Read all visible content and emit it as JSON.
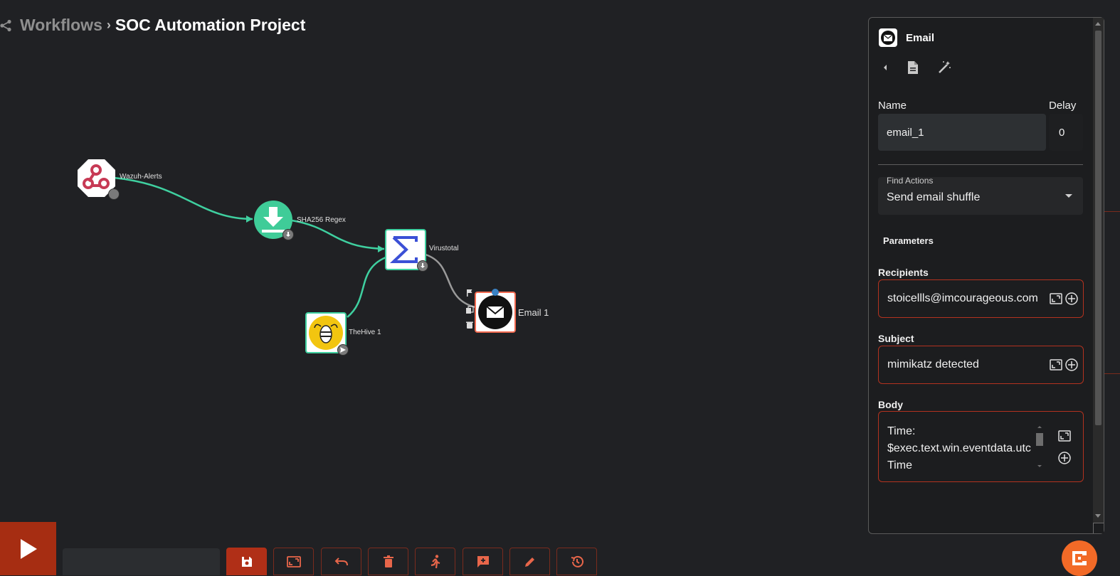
{
  "breadcrumb": {
    "workflows": "Workflows",
    "separator": "›",
    "project": "SOC Automation Project"
  },
  "nodes": {
    "wazuh": {
      "label": "Wazuh-Alerts",
      "icon": "webhook-icon"
    },
    "sha": {
      "label": "SHA256 Regex",
      "icon": "download-icon"
    },
    "virustotal": {
      "label": "Virustotal",
      "icon": "sigma-icon"
    },
    "thehive": {
      "label": "TheHive 1",
      "icon": "bee-icon"
    },
    "email": {
      "label": "Email 1",
      "icon": "mail-icon"
    }
  },
  "panel": {
    "title": "Email",
    "name_label": "Name",
    "delay_label": "Delay",
    "name_value": "email_1",
    "delay_value": "0",
    "find_actions_label": "Find Actions",
    "find_actions_value": "Send email shuffle",
    "parameters_title": "Parameters",
    "recipients_label": "Recipients",
    "recipients_value": "stoicellls@imcourageous.com",
    "subject_label": "Subject",
    "subject_value": "mimikatz detected",
    "body_label": "Body",
    "body_line1": "Time:",
    "body_line2": "$exec.text.win.eventdata.utc",
    "body_line3": "Time"
  },
  "colors": {
    "accent": "#b02f17",
    "edge_green": "#3fd0a0",
    "edge_gray": "#9a9a9a",
    "logo_orange": "#f26a27"
  }
}
